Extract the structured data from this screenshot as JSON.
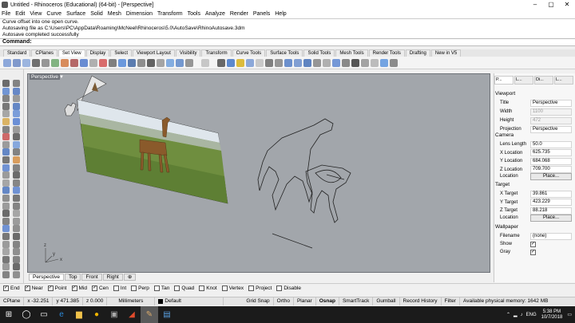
{
  "window": {
    "title": "Untitled - Rhinoceros (Educational) (64-bit) - [Perspective]",
    "controls": [
      "–",
      "▢",
      "✕"
    ]
  },
  "menu": [
    "File",
    "Edit",
    "View",
    "Curve",
    "Surface",
    "Solid",
    "Mesh",
    "Dimension",
    "Transform",
    "Tools",
    "Analyze",
    "Render",
    "Panels",
    "Help"
  ],
  "command_history": [
    "Curve offset into one open curve.",
    "Autosaving file as C:\\Users\\PC\\AppData\\Roaming\\McNeel\\Rhinoceros\\5.0\\AutoSave\\RhinoAutosave.3dm",
    "Autosave completed successfully"
  ],
  "command_prompt": "Command:",
  "toolbar_tabs": [
    {
      "label": "Standard",
      "active": false
    },
    {
      "label": "CPlanes",
      "active": false
    },
    {
      "label": "Set View",
      "active": true
    },
    {
      "label": "Display",
      "active": false
    },
    {
      "label": "Select",
      "active": false
    },
    {
      "label": "Viewport Layout",
      "active": false
    },
    {
      "label": "Visibility",
      "active": false
    },
    {
      "label": "Transform",
      "active": false
    },
    {
      "label": "Curve Tools",
      "active": false
    },
    {
      "label": "Surface Tools",
      "active": false
    },
    {
      "label": "Solid Tools",
      "active": false
    },
    {
      "label": "Mesh Tools",
      "active": false
    },
    {
      "label": "Render Tools",
      "active": false
    },
    {
      "label": "Drafting",
      "active": false
    },
    {
      "label": "New in V5",
      "active": false
    }
  ],
  "viewport": {
    "label": "Perspective",
    "axes": {
      "x": "x",
      "y": "y",
      "z": "z"
    }
  },
  "viewport_tabs": [
    {
      "label": "Perspective",
      "active": true
    },
    {
      "label": "Top",
      "active": false
    },
    {
      "label": "Front",
      "active": false
    },
    {
      "label": "Right",
      "active": false
    },
    {
      "label": "⊕",
      "active": false
    }
  ],
  "panel": {
    "tabs": [
      "P...",
      "L...",
      "Di...",
      "L..."
    ],
    "viewport_section": "Viewport",
    "viewport_rows": [
      {
        "label": "Title",
        "value": "Perspective",
        "disabled": false
      },
      {
        "label": "Width",
        "value": "1100",
        "disabled": true
      },
      {
        "label": "Height",
        "value": "472",
        "disabled": true
      },
      {
        "label": "Projection",
        "value": "Perspective",
        "disabled": false
      }
    ],
    "camera_section": "Camera",
    "camera_rows": [
      {
        "label": "Lens Length",
        "value": "50.0"
      },
      {
        "label": "X Location",
        "value": "625.735"
      },
      {
        "label": "Y Location",
        "value": "684.068"
      },
      {
        "label": "Z Location",
        "value": "709.700"
      }
    ],
    "camera_location_label": "Location",
    "camera_place": "Place...",
    "target_section": "Target",
    "target_rows": [
      {
        "label": "X Target",
        "value": "39.861"
      },
      {
        "label": "Y Target",
        "value": "423.229"
      },
      {
        "label": "Z Target",
        "value": "88.218"
      }
    ],
    "target_location_label": "Location",
    "target_place": "Place...",
    "wallpaper_section": "Wallpaper",
    "filename_label": "Filename",
    "filename_value": "(none)",
    "show_label": "Show",
    "show_checked": true,
    "gray_label": "Gray",
    "gray_checked": true
  },
  "osnaps": [
    {
      "label": "End",
      "checked": true
    },
    {
      "label": "Near",
      "checked": true
    },
    {
      "label": "Point",
      "checked": true
    },
    {
      "label": "Mid",
      "checked": true
    },
    {
      "label": "Cen",
      "checked": true
    },
    {
      "label": "Int",
      "checked": false
    },
    {
      "label": "Perp",
      "checked": false
    },
    {
      "label": "Tan",
      "checked": false
    },
    {
      "label": "Quad",
      "checked": false
    },
    {
      "label": "Knot",
      "checked": false
    },
    {
      "label": "Vertex",
      "checked": false
    },
    {
      "label": "Project",
      "checked": false
    },
    {
      "label": "Disable",
      "checked": false
    }
  ],
  "status": {
    "cplane": "CPlane",
    "x": "x -32.251",
    "y": "y 471.385",
    "z": "z 0.000",
    "units": "Millimeters",
    "layer": "Default",
    "toggles": [
      "Grid Snap",
      "Ortho",
      "Planar",
      "Osnap",
      "SmartTrack",
      "Gumball",
      "Record History",
      "Filter"
    ],
    "active_toggle": "Osnap",
    "memory": "Available physical memory: 1642 MB"
  },
  "taskbar": {
    "lang": "ENG",
    "time": "5:38 PM",
    "date": "10/7/2018"
  },
  "colors": {
    "viewport_bg": "#a2a6ab",
    "taskbar_bg": "#1b1b1b"
  }
}
